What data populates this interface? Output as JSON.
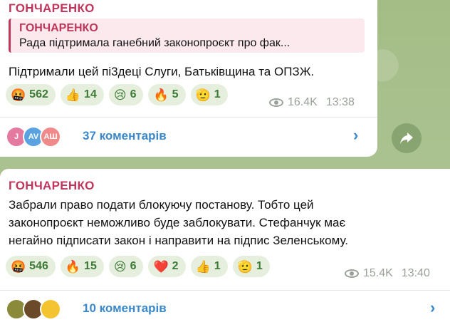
{
  "messages": [
    {
      "author": "ГОНЧАРЕНКО",
      "quote": {
        "author": "ГОНЧАРЕНКО",
        "text": "Рада підтримала ганебний законопроєкт про фак..."
      },
      "text": "Підтримали цей пі3деці Слуги, Батьківщина та ОПЗЖ.",
      "reactions": [
        {
          "emoji": "🤬",
          "count": "562"
        },
        {
          "emoji": "👍",
          "count": "14"
        },
        {
          "emoji": "😢",
          "count": "6"
        },
        {
          "emoji": "🔥",
          "count": "5"
        },
        {
          "emoji": "🫡",
          "count": "1"
        }
      ],
      "views": "16.4K",
      "time": "13:38",
      "comments": {
        "label": "37 коментарів",
        "avatars": [
          {
            "initials": "J",
            "color": "#e57aa0"
          },
          {
            "initials": "AV",
            "color": "#5aa3e0"
          },
          {
            "initials": "АШ",
            "color": "#f08a8a"
          }
        ]
      }
    },
    {
      "author": "ГОНЧАРЕНКО",
      "text": "Забрали право подати блокуючу постанову. Тобто цей\nзаконопроєкт неможливо буде заблокувати. Стефанчук має\nнегайно підписати закон і направити на підпис Зеленському.",
      "reactions": [
        {
          "emoji": "🤬",
          "count": "546"
        },
        {
          "emoji": "🔥",
          "count": "15"
        },
        {
          "emoji": "😢",
          "count": "6"
        },
        {
          "emoji": "❤️",
          "count": "2"
        },
        {
          "emoji": "👍",
          "count": "1"
        },
        {
          "emoji": "🫡",
          "count": "1"
        }
      ],
      "views": "15.4K",
      "time": "13:40",
      "comments": {
        "label": "10 коментарів",
        "avatars": [
          {
            "initials": "",
            "color": "#8a8a3a"
          },
          {
            "initials": "",
            "color": "#6b4a2a"
          },
          {
            "initials": "",
            "color": "#f4c430"
          }
        ]
      }
    }
  ],
  "icons": {
    "views": "eye-icon",
    "share": "share-arrow-icon",
    "chevron": "chevron-right-icon"
  }
}
